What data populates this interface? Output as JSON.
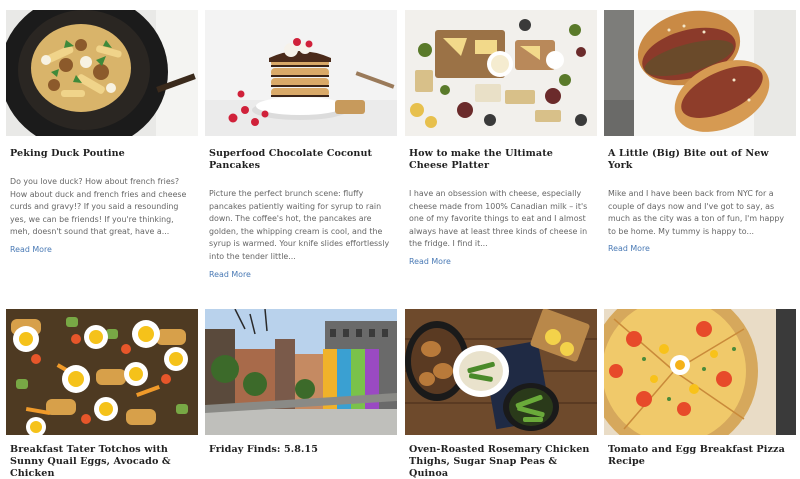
{
  "posts": [
    {
      "title": "Peking Duck Poutine",
      "excerpt": "Do you love duck? How about french fries? How about duck and french fries and cheese curds and gravy!? If you said a resounding yes, we can be friends! If you're thinking, meh, doesn't sound that great, have a...",
      "read_more": "Read More",
      "image_icon": "poutine-skillet-photo"
    },
    {
      "title": "Superfood Chocolate Coconut Pancakes",
      "excerpt": "Picture the perfect brunch scene: fluffy pancakes patiently waiting for syrup to rain down. The coffee's hot, the pancakes are golden, the whipping cream is cool, and the syrup is warmed. Your knife slides effortlessly into the tender little...",
      "read_more": "Read More",
      "image_icon": "pancake-stack-photo"
    },
    {
      "title": "How to make the Ultimate Cheese Platter",
      "excerpt": "I have an obsession with cheese, especially cheese made from 100% Canadian milk – it's one of my favorite things to eat and I almost always have at least three kinds of cheese in the fridge. I find it...",
      "read_more": "Read More",
      "image_icon": "cheese-platter-photo"
    },
    {
      "title": "A Little (Big) Bite out of New York",
      "excerpt": "Mike and I have been back from NYC for a couple of days now and I've got to say, as much as the city was a ton of fun, I'm happy to be home. My tummy is happy to...",
      "read_more": "Read More",
      "image_icon": "sandwich-photo"
    },
    {
      "title": "Breakfast Tater Totchos with Sunny Quail Eggs, Avocado & Chicken",
      "image_icon": "totchos-photo"
    },
    {
      "title": "Friday Finds: 5.8.15",
      "image_icon": "city-street-photo"
    },
    {
      "title": "Oven-Roasted Rosemary Chicken Thighs, Sugar Snap Peas & Quinoa",
      "image_icon": "chicken-skillet-photo"
    },
    {
      "title": "Tomato and Egg Breakfast Pizza Recipe",
      "image_icon": "pizza-photo"
    }
  ],
  "colors": {
    "link": "#4a7ab5",
    "title": "#222222",
    "excerpt": "#666666"
  }
}
